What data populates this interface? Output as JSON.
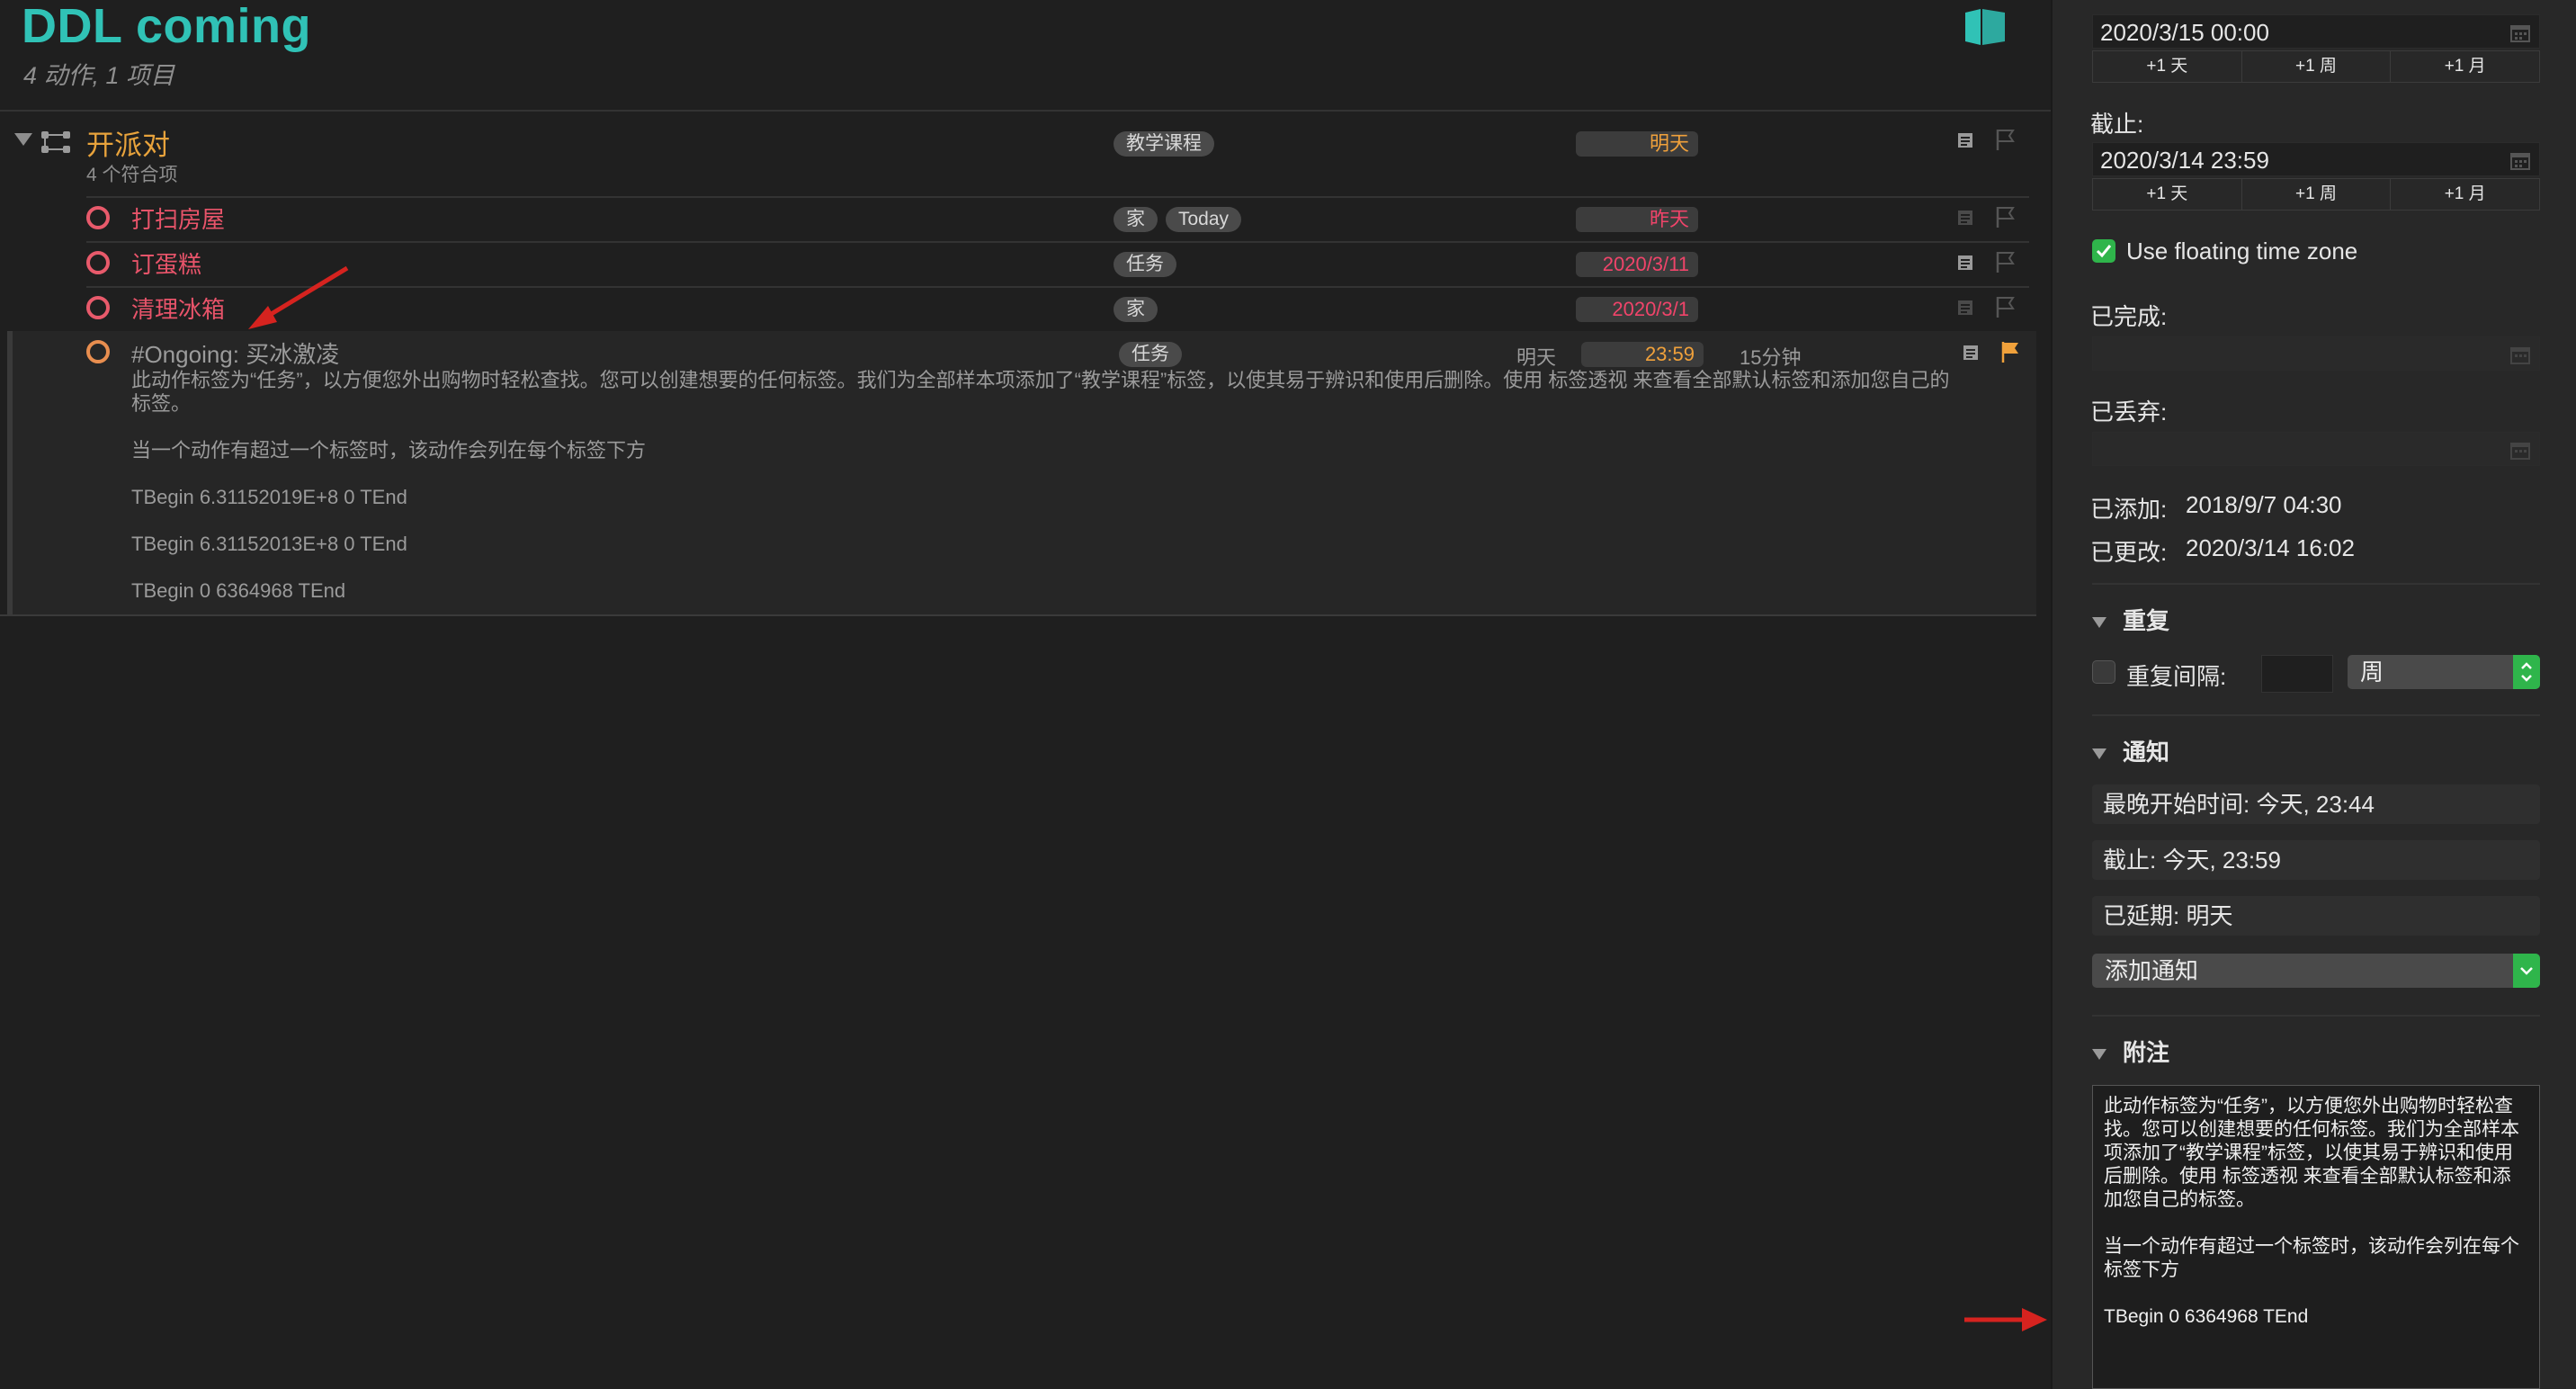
{
  "header": {
    "title": "DDL coming",
    "subtitle": "4 动作, 1 项目"
  },
  "project": {
    "name": "开派对",
    "count": "4 个符合项",
    "tag": "教学课程",
    "due": "明天"
  },
  "tasks": [
    {
      "name": "打扫房屋",
      "tags": [
        "家",
        "Today"
      ],
      "due": "昨天"
    },
    {
      "name": "订蛋糕",
      "tags": [
        "任务"
      ],
      "due": "2020/3/11"
    },
    {
      "name": "清理冰箱",
      "tags": [
        "家"
      ],
      "due": "2020/3/1"
    }
  ],
  "selected": {
    "name": "#Ongoing: 买冰激凌",
    "tag": "任务",
    "defer": "明天",
    "due": "23:59",
    "estimate": "15分钟",
    "note_line1": "此动作标签为“任务”，以方便您外出购物时轻松查找。您可以创建想要的任何标签。我们为全部样本项添加了“教学课程”标签，以使其易于辨识和使用后删除。使用 标签透视 来查看全部默认标签和添加您自己的",
    "note_line1b": "标签。",
    "note_line2": "当一个动作有超过一个标签时，该动作会列在每个标签下方",
    "note_line3": "TBegin 6.31152019E+8 0 TEnd",
    "note_line4": "TBegin 6.31152013E+8 0 TEnd",
    "note_line5": "TBegin 0 6364968 TEnd"
  },
  "inspector": {
    "defer_value": "2020/3/15 00:00",
    "step_day": "+1 天",
    "step_week": "+1 周",
    "step_month": "+1 月",
    "due_label": "截止:",
    "due_value": "2020/3/14 23:59",
    "floating_label": "Use floating time zone",
    "completed_label": "已完成:",
    "dropped_label": "已丢弃:",
    "added_label": "已添加:",
    "added_value": "2018/9/7 04:30",
    "changed_label": "已更改:",
    "changed_value": "2020/3/14 16:02",
    "repeat_section": "重复",
    "repeat_interval_label": "重复间隔:",
    "repeat_unit": "周",
    "notify_section": "通知",
    "notify_latest_start": "最晚开始时间: 今天, 23:44",
    "notify_due": "截止: 今天, 23:59",
    "notify_deferred": "已延期: 明天",
    "add_notification": "添加通知",
    "notes_section": "附注",
    "notes_p1": "此动作标签为“任务”，以方便您外出购物时轻松查找。您可以创建想要的任何标签。我们为全部样本项添加了“教学课程”标签，以使其易于辨识和使用后删除。使用 标签透视 来查看全部默认标签和添加您自己的标签。",
    "notes_p2": "当一个动作有超过一个标签时，该动作会列在每个标签下方",
    "notes_p3": "TBegin 0 6364968 TEnd"
  },
  "colors": {
    "accent": "#30c2b6",
    "project": "#e8a33c",
    "overdue": "#f0446a",
    "due_soon": "#f0a13b",
    "check_green": "#2fb54b",
    "arrow_red": "#d6231f"
  }
}
